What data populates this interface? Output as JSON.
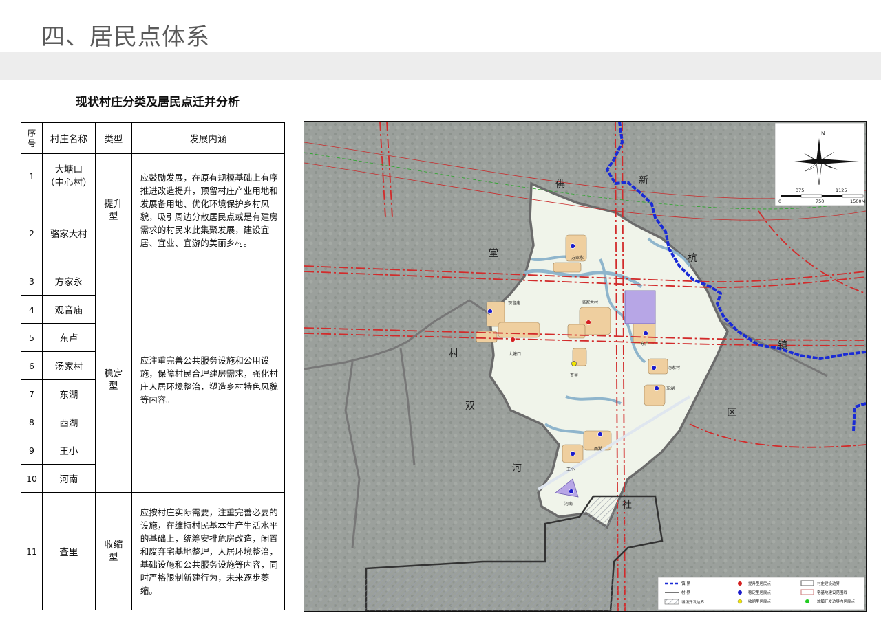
{
  "page": {
    "title": "四、居民点体系"
  },
  "table": {
    "title": "现状村庄分类及居民点迁并分析",
    "headers": {
      "seq": "序号",
      "name": "村庄名称",
      "type": "类型",
      "content": "发展内涵"
    },
    "groups": [
      {
        "type": "提升型",
        "content": "应鼓励发展，在原有规模基础上有序推进改造提升，预留村庄产业用地和发展备用地、优化环境保护乡村风貌，吸引周边分散居民点或是有建房需求的村民来此集聚发展，建设宜居、宜业、宜游的美丽乡村。",
        "rows": [
          {
            "seq": "1",
            "name": "大塘口",
            "note": "（中心村）"
          },
          {
            "seq": "2",
            "name": "骆家大村"
          }
        ]
      },
      {
        "type": "稳定型",
        "content": "应注重完善公共服务设施和公用设施，保障村民合理建房需求，强化村庄人居环境整治，塑造乡村特色风貌等内容。",
        "rows": [
          {
            "seq": "3",
            "name": "方家永"
          },
          {
            "seq": "4",
            "name": "观音庙"
          },
          {
            "seq": "5",
            "name": "东卢"
          },
          {
            "seq": "6",
            "name": "汤家村"
          },
          {
            "seq": "7",
            "name": "东湖"
          },
          {
            "seq": "8",
            "name": "西湖"
          },
          {
            "seq": "9",
            "name": "王小"
          },
          {
            "seq": "10",
            "name": "河南"
          }
        ]
      },
      {
        "type": "收缩型",
        "content": "应按村庄实际需要，注重完善必要的设施，在维持村民基本生产生活水平的基础上，统筹安排危房改造，闲置和废弃宅基地整理，人居环境整治，基础设施和公共服务设施等内容，同时严格限制新建行为，未来逐步萎缩。",
        "rows": [
          {
            "seq": "11",
            "name": "查里"
          }
        ]
      }
    ]
  },
  "map": {
    "big_labels": [
      "佛",
      "堂",
      "村",
      "双",
      "河",
      "社",
      "新",
      "杭",
      "镇",
      "区"
    ],
    "village_labels": [
      "方家永",
      "骆家大村",
      "观音庙",
      "大塘口",
      "东卢",
      "查里",
      "汤家村",
      "东湖",
      "西湖",
      "王小",
      "河南"
    ],
    "compass": {
      "north": "N",
      "scale_top": [
        "375",
        "1125"
      ],
      "scale_bottom": [
        "0",
        "750",
        "1500M"
      ]
    },
    "legend": [
      "镇 界",
      "村 界",
      "城镇开发边界",
      "提升型居民点",
      "稳定型居民点",
      "收缩型居民点",
      "村庄建设边界",
      "宅基地建设范围线",
      "城镇开发边界内居民点"
    ],
    "colors": {
      "town_boundary": "#1a2bd6",
      "village_boundary": "#555555",
      "upgrade": "#d42020",
      "stable": "#1c1ccc",
      "shrink": "#f2e600",
      "in_town": "#22cc22"
    }
  }
}
